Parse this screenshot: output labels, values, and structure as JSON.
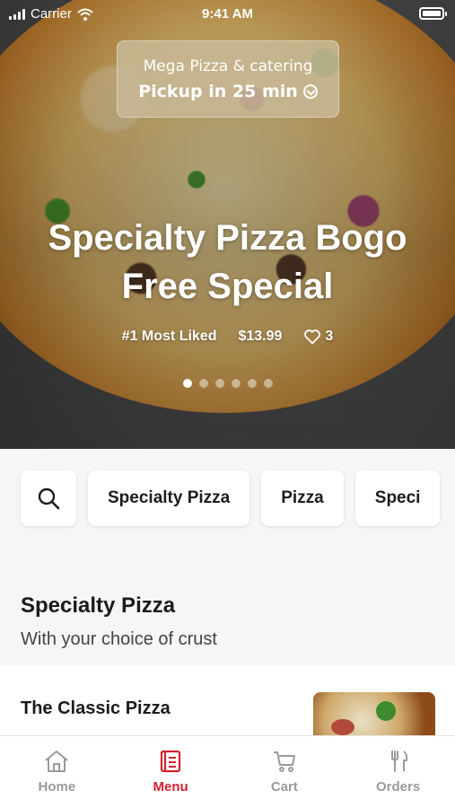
{
  "status_bar": {
    "carrier": "Carrier",
    "time": "9:41 AM"
  },
  "pickup": {
    "restaurant": "Mega Pizza & catering",
    "eta": "Pickup in 25 min"
  },
  "hero": {
    "title": "Specialty Pizza Bogo Free Special",
    "badge": "#1 Most Liked",
    "price": "$13.99",
    "likes": "3",
    "carousel_total": 6,
    "carousel_active": 1
  },
  "categories": {
    "items": [
      "Specialty Pizza",
      "Pizza",
      "Speci"
    ]
  },
  "section": {
    "title": "Specialty Pizza",
    "subtitle": "With your choice of crust"
  },
  "menu_items": [
    {
      "name": "The Classic Pizza"
    }
  ],
  "tabbar": {
    "home": "Home",
    "menu": "Menu",
    "cart": "Cart",
    "orders": "Orders",
    "active": "Menu"
  },
  "colors": {
    "accent": "#d3232f",
    "inactive": "#9a9a9a"
  }
}
